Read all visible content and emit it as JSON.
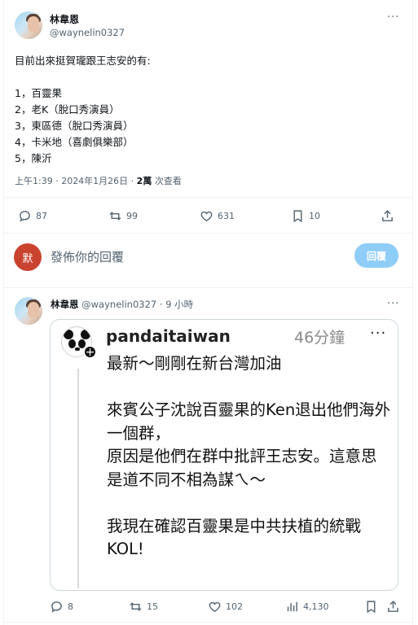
{
  "main_tweet": {
    "author_name": "林韋恩",
    "handle": "@waynelin0327",
    "more": "···",
    "text": "目前出來挺賀瓏跟王志安的有:\n\n1，百靈果\n2，老K（脫口秀演員）\n3，東區德（脫口秀演員）\n4，卡米地（喜劇俱樂部）\n5，陳沂",
    "timestamp": "上午1:39 · 2024年1月26日 · ",
    "views_count": "2萬",
    "views_label": " 次查看",
    "stats": {
      "replies": "87",
      "retweets": "99",
      "likes": "631",
      "bookmarks": "10"
    }
  },
  "reply_box": {
    "avatar_char": "默",
    "placeholder": "發佈你的回覆",
    "button": "回覆",
    "accent": "#8ecdf7"
  },
  "second_tweet": {
    "author_name": "林韋恩",
    "handle_time": " @waynelin0327 · 9 小時",
    "more": "···",
    "embedded": {
      "username": "pandaitaiwan",
      "time": "46分鐘",
      "more": "···",
      "plus": "+",
      "text": "最新～剛剛在新台灣加油\n\n來賓公子沈說百靈果的Ken退出他們海外一個群，\n原因是他們在群中批評王志安。這意思是道不同不相為謀ㄟ～\n\n我現在確認百靈果是中共扶植的統戰 KOL!"
    },
    "stats": {
      "replies": "8",
      "retweets": "15",
      "likes": "102",
      "views": "4,130"
    }
  }
}
